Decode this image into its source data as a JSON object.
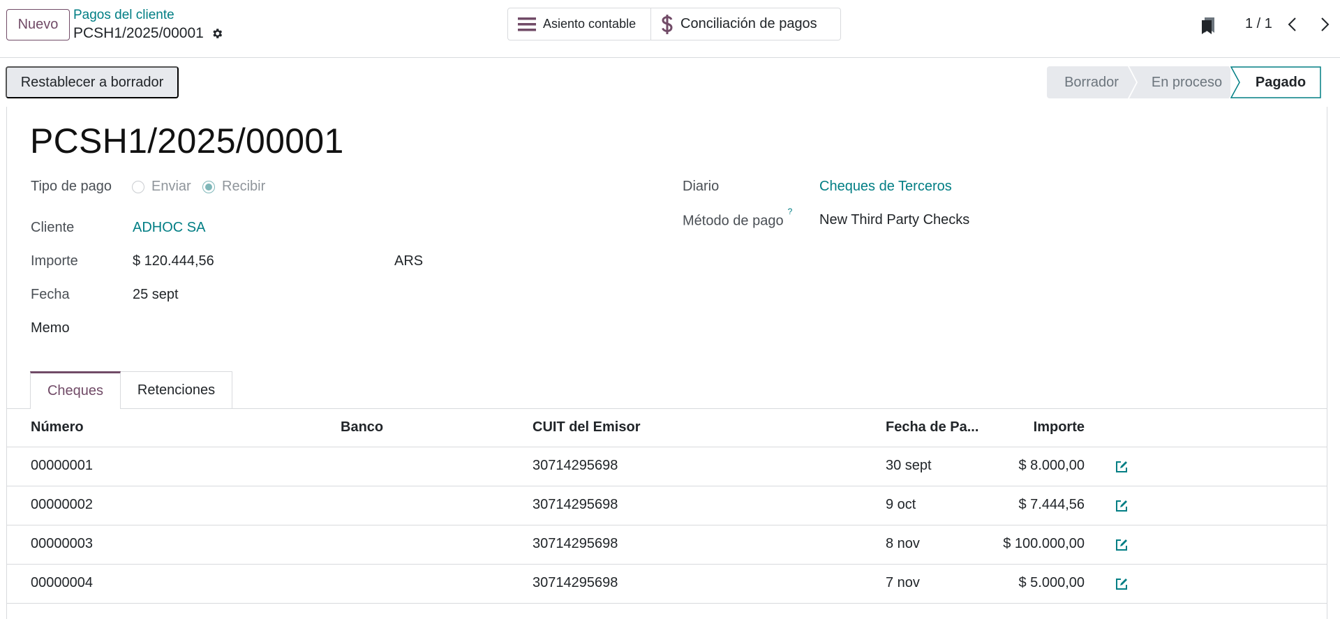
{
  "control_panel": {
    "new_button": "Nuevo",
    "breadcrumb": "Pagos del cliente",
    "record_name": "PCSH1/2025/00001",
    "smart_buttons": [
      {
        "label": "Asiento contable",
        "icon": "list-icon"
      },
      {
        "label": "Conciliación de pagos",
        "icon": "dollar-icon"
      }
    ],
    "pager": "1 / 1"
  },
  "status": {
    "reset_button": "Restablecer a borrador",
    "stages": [
      "Borrador",
      "En proceso",
      "Pagado"
    ],
    "active_stage": "Pagado"
  },
  "form": {
    "title": "PCSH1/2025/00001",
    "payment_type": {
      "label": "Tipo de pago",
      "options": [
        "Enviar",
        "Recibir"
      ],
      "selected": "Recibir"
    },
    "customer": {
      "label": "Cliente",
      "value": "ADHOC SA"
    },
    "amount": {
      "label": "Importe",
      "value": "$ 120.444,56",
      "currency": "ARS"
    },
    "date": {
      "label": "Fecha",
      "value": "25 sept"
    },
    "memo": {
      "label": "Memo"
    },
    "journal": {
      "label": "Diario",
      "value": "Cheques de Terceros"
    },
    "payment_method": {
      "label": "Método de pago",
      "help": "?",
      "value": "New Third Party Checks"
    }
  },
  "tabs": [
    "Cheques",
    "Retenciones"
  ],
  "checks_table": {
    "columns": [
      "Número",
      "Banco",
      "CUIT del Emisor",
      "Fecha de Pa...",
      "Importe"
    ],
    "rows": [
      {
        "number": "00000001",
        "bank": "",
        "cuit": "30714295698",
        "date": "30 sept",
        "amount": "$ 8.000,00"
      },
      {
        "number": "00000002",
        "bank": "",
        "cuit": "30714295698",
        "date": "9 oct",
        "amount": "$ 7.444,56"
      },
      {
        "number": "00000003",
        "bank": "",
        "cuit": "30714295698",
        "date": "8 nov",
        "amount": "$ 100.000,00"
      },
      {
        "number": "00000004",
        "bank": "",
        "cuit": "30714295698",
        "date": "7 nov",
        "amount": "$ 5.000,00"
      }
    ]
  },
  "colors": {
    "brand": "#714b67",
    "link": "#017e84",
    "border": "#d8dadd"
  }
}
